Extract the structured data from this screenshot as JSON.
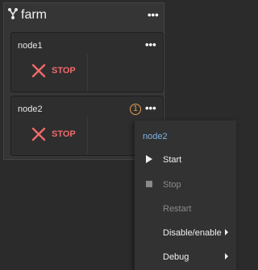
{
  "farm": {
    "title": "farm",
    "more_label": "•••",
    "icon": "network-icon"
  },
  "nodes": [
    {
      "name": "node1",
      "more_label": "•••",
      "action_label": "STOP"
    },
    {
      "name": "node2",
      "more_label": "•••",
      "action_label": "STOP",
      "badge": "1"
    }
  ],
  "context_menu": {
    "title": "node2",
    "items": [
      {
        "label": "Start",
        "icon": "play-icon",
        "enabled": true
      },
      {
        "label": "Stop",
        "icon": "stop-square-icon",
        "enabled": false
      },
      {
        "label": "Restart",
        "enabled": false
      },
      {
        "label": "Disable/enable",
        "submenu": true,
        "enabled": true
      },
      {
        "label": "Debug",
        "submenu": true,
        "enabled": true
      }
    ]
  },
  "colors": {
    "background": "#2b2b2b",
    "panel": "#353535",
    "card": "#2e2e2e",
    "stop": "#f06a6a",
    "badge": "#e0a050",
    "menu_title": "#7fb3e6"
  }
}
